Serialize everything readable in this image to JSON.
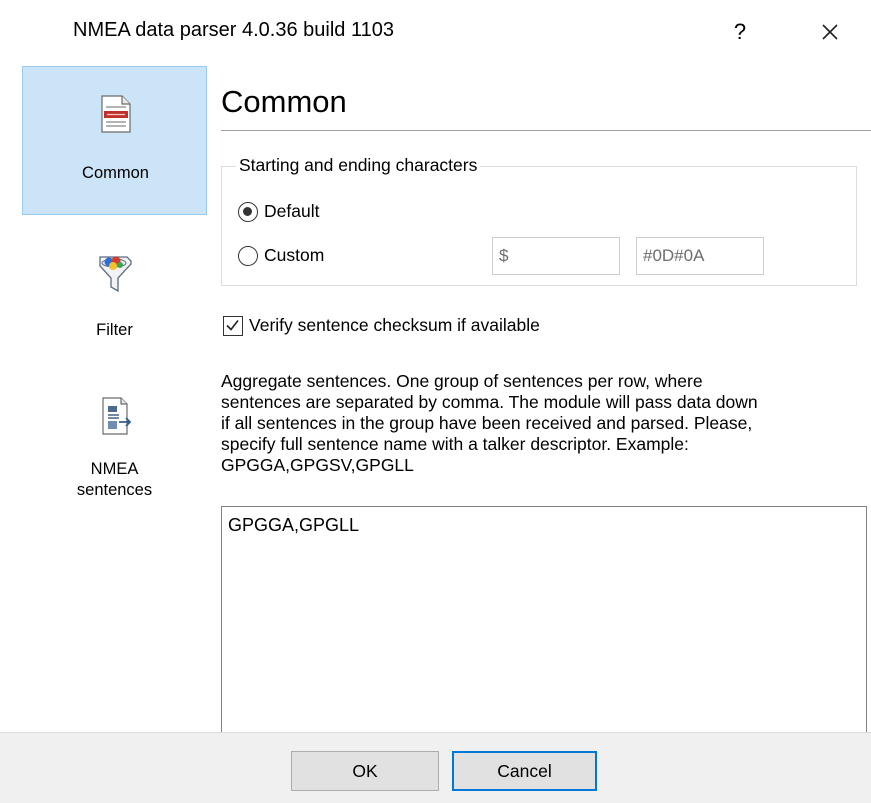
{
  "window": {
    "title": "NMEA data parser 4.0.36 build 1103",
    "help_glyph": "?",
    "close_icon": "close-icon"
  },
  "nav": {
    "items": [
      {
        "label": "Common",
        "icon": "document-icon",
        "selected": true
      },
      {
        "label": "Filter",
        "icon": "funnel-icon",
        "selected": false
      },
      {
        "label_line1": "NMEA",
        "label_line2": "sentences",
        "icon": "sentences-icon",
        "selected": false
      }
    ]
  },
  "content": {
    "heading": "Common",
    "group": {
      "legend": "Starting and ending characters",
      "default_label": "Default",
      "custom_label": "Custom",
      "default_selected": true,
      "start_char_value": "$",
      "end_char_value": "#0D#0A"
    },
    "verify_checksum": {
      "label": "Verify sentence checksum if available",
      "checked": true
    },
    "description_lines": [
      "Aggregate sentences. One group of sentences per row, where",
      "sentences are separated by comma. The module will pass data down",
      "if all sentences in the group have been received and parsed. Please,",
      "specify full sentence name with a talker descriptor. Example:",
      "GPGGA,GPGSV,GPGLL"
    ],
    "aggregate_value": "GPGGA,GPGLL"
  },
  "footer": {
    "ok_label": "OK",
    "cancel_label": "Cancel"
  },
  "colors": {
    "selection_bg": "#cce4f7",
    "selection_border": "#99c9ef",
    "accent": "#0078d7"
  }
}
